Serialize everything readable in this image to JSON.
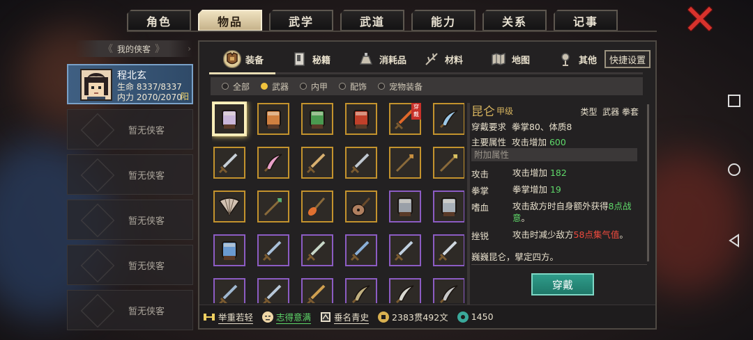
{
  "top_tabs": [
    {
      "label": "角色",
      "active": false
    },
    {
      "label": "物品",
      "active": true
    },
    {
      "label": "武学",
      "active": false
    },
    {
      "label": "武道",
      "active": false
    },
    {
      "label": "能力",
      "active": false
    },
    {
      "label": "关系",
      "active": false
    },
    {
      "label": "记事",
      "active": false
    }
  ],
  "roster": {
    "header": "我的侠客",
    "hero": {
      "name": "程北玄",
      "hp": "生命 8337/8337",
      "mp": "内力 2070/2070",
      "tag": "阳"
    },
    "empty_label": "暂无侠客",
    "empty_count": 5
  },
  "categories": [
    {
      "label": "装备",
      "icon": "armor-icon",
      "active": true
    },
    {
      "label": "秘籍",
      "icon": "book-icon",
      "active": false
    },
    {
      "label": "消耗品",
      "icon": "potion-icon",
      "active": false
    },
    {
      "label": "材料",
      "icon": "herb-icon",
      "active": false
    },
    {
      "label": "地图",
      "icon": "map-icon",
      "active": false
    },
    {
      "label": "其他",
      "icon": "misc-icon",
      "active": false
    }
  ],
  "quick_settings": "快捷设置",
  "filters": [
    {
      "label": "全部",
      "on": false
    },
    {
      "label": "武器",
      "on": true
    },
    {
      "label": "内甲",
      "on": false
    },
    {
      "label": "配饰",
      "on": false
    },
    {
      "label": "宠物装备",
      "on": false
    }
  ],
  "items": [
    {
      "name": "gauntlet-icon",
      "rarity": "gold",
      "selected": true,
      "color": "#c9b6d8"
    },
    {
      "name": "gauntlet-icon",
      "rarity": "gold",
      "color": "#d08040"
    },
    {
      "name": "gauntlet-icon",
      "rarity": "gold",
      "color": "#4a9a50"
    },
    {
      "name": "gauntlet-icon",
      "rarity": "gold",
      "color": "#c0402a"
    },
    {
      "name": "sword-icon",
      "rarity": "gold",
      "color": "#e0682a",
      "badge": "穿戴"
    },
    {
      "name": "blade-icon",
      "rarity": "gold",
      "color": "#9cc8e8"
    },
    {
      "name": "sword-icon",
      "rarity": "gold",
      "color": "#c8d0d8"
    },
    {
      "name": "blade-icon",
      "rarity": "gold",
      "color": "#e8a0c8"
    },
    {
      "name": "sword-icon",
      "rarity": "gold",
      "color": "#d8b070"
    },
    {
      "name": "sword-icon",
      "rarity": "gold",
      "color": "#c0c8d0"
    },
    {
      "name": "spear-icon",
      "rarity": "gold",
      "color": "#c89040"
    },
    {
      "name": "spear-icon",
      "rarity": "gold",
      "color": "#d8c060"
    },
    {
      "name": "fan-icon",
      "rarity": "gold",
      "color": "#d0c0b0"
    },
    {
      "name": "spear-icon",
      "rarity": "gold",
      "color": "#5ab070"
    },
    {
      "name": "brush-icon",
      "rarity": "gold",
      "color": "#e07030"
    },
    {
      "name": "lute-icon",
      "rarity": "gold",
      "color": "#b08060"
    },
    {
      "name": "gauntlet-icon",
      "rarity": "purple",
      "color": "#9aa0a8"
    },
    {
      "name": "gauntlet-icon",
      "rarity": "purple",
      "color": "#a8b0b8"
    },
    {
      "name": "gauntlet-icon",
      "rarity": "purple",
      "color": "#6a9ad0"
    },
    {
      "name": "sword-icon",
      "rarity": "purple",
      "color": "#a8c0d8"
    },
    {
      "name": "sword-icon",
      "rarity": "purple",
      "color": "#c8d8c8"
    },
    {
      "name": "sword-icon",
      "rarity": "purple",
      "color": "#8ab0d8"
    },
    {
      "name": "sword-icon",
      "rarity": "purple",
      "color": "#c0d0e0"
    },
    {
      "name": "sword-icon",
      "rarity": "purple",
      "color": "#d0d8e0"
    },
    {
      "name": "sword-icon",
      "rarity": "purple",
      "color": "#a0b8d0"
    },
    {
      "name": "sword-icon",
      "rarity": "purple",
      "color": "#b8c8d8"
    },
    {
      "name": "sword-icon",
      "rarity": "purple",
      "color": "#d0a050"
    },
    {
      "name": "blade-icon",
      "rarity": "purple",
      "color": "#c0b080"
    },
    {
      "name": "blade-icon",
      "rarity": "purple",
      "color": "#d8d8d0"
    },
    {
      "name": "blade-icon",
      "rarity": "purple",
      "color": "#c8c8c8"
    }
  ],
  "detail": {
    "name": "昆仑",
    "grade": "甲级",
    "type_label": "类型",
    "type_value": "武器 拳套",
    "req_label": "穿戴要求",
    "req_value": "拳掌80、体质8",
    "main_label": "主要属性",
    "main_value": "攻击增加",
    "main_num": "600",
    "extra_label": "附加属性",
    "attrs": [
      {
        "key": "攻击",
        "text": "攻击增加 ",
        "hl": "182",
        "hl_color": "green",
        "tail": ""
      },
      {
        "key": "拳掌",
        "text": "拳掌增加 ",
        "hl": "19",
        "hl_color": "green",
        "tail": ""
      },
      {
        "key": "嗜血",
        "text": "攻击敌方时自身额外获得",
        "hl": "8点战意",
        "hl_color": "green",
        "tail": "。"
      },
      {
        "key": "挫锐",
        "text": "攻击时减少敌方",
        "hl": "58点集气值",
        "hl_color": "red",
        "tail": "。"
      }
    ],
    "flavor": "巍巍昆仑，擘定四方。"
  },
  "equip_button": "穿戴",
  "bottom": {
    "s1": "举重若轻",
    "s2": "志得意满",
    "s3": "垂名青史",
    "money": "2383贯492文",
    "jade": "1450"
  }
}
